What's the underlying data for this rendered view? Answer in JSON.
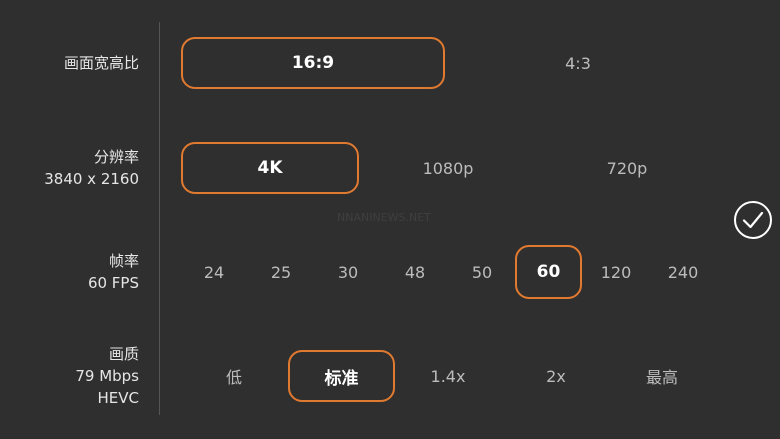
{
  "aspect_ratio": {
    "label": "画面宽高比",
    "options": [
      "16:9",
      "4:3"
    ],
    "selected": "16:9"
  },
  "resolution": {
    "label": "分辨率",
    "value": "3840 x 2160",
    "options": [
      "4K",
      "1080p",
      "720p"
    ],
    "selected": "4K"
  },
  "frame_rate": {
    "label": "帧率",
    "value": "60 FPS",
    "options": [
      "24",
      "25",
      "30",
      "48",
      "50",
      "60",
      "120",
      "240"
    ],
    "selected": "60"
  },
  "quality": {
    "label": "画质",
    "bitrate": "79 Mbps",
    "codec": "HEVC",
    "options": [
      "低",
      "标准",
      "1.4x",
      "2x",
      "最高"
    ],
    "selected": "标准"
  },
  "watermark": "NNANINEWS.NET",
  "colors": {
    "background": "#2f2f2f",
    "accent": "#e07a30",
    "text_selected": "#ffffff",
    "text_option": "#bcbcbc"
  },
  "icons": {
    "confirm": "checkmark-circle-icon"
  }
}
